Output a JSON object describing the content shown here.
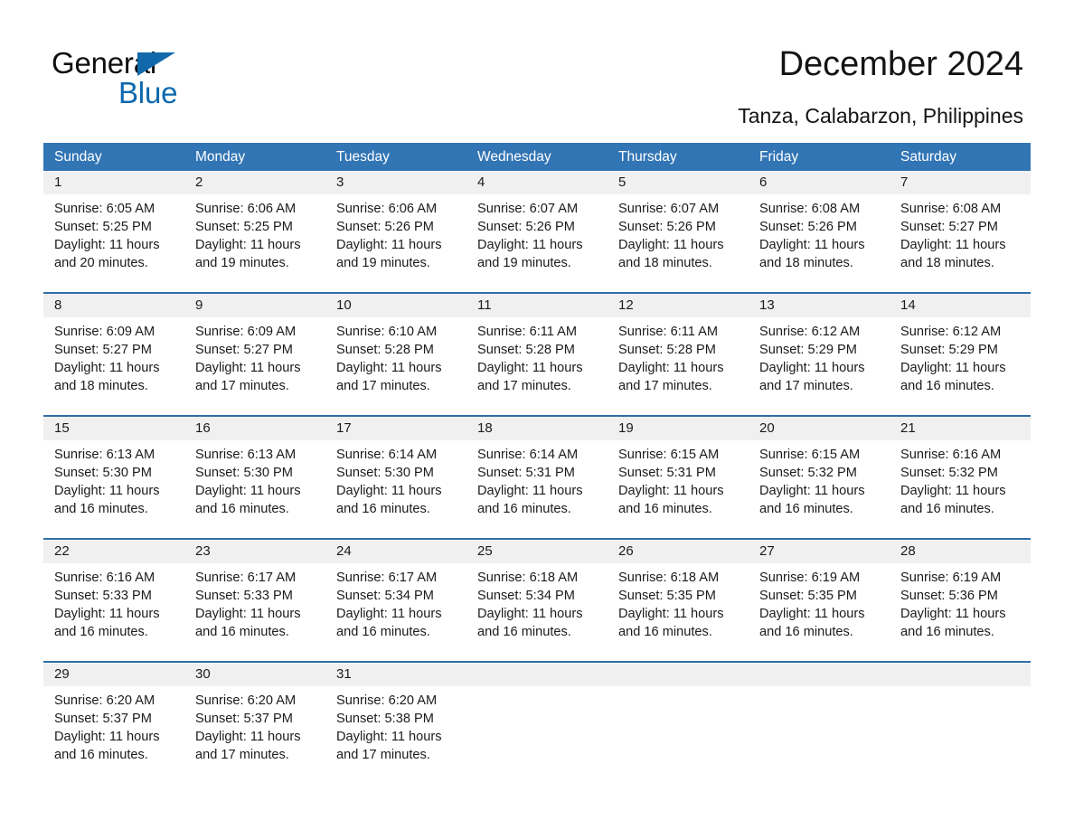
{
  "brand": {
    "word1": "General",
    "word2": "Blue",
    "triangle_color": "#1169ab",
    "text_color": "#0d68ae"
  },
  "header": {
    "title": "December 2024",
    "location": "Tanza, Calabarzon, Philippines"
  },
  "theme": {
    "header_row_bg": "#3275b4",
    "week_divider": "#2f6fa8",
    "daynum_band_bg": "#f0f0f0",
    "text": "#1b1b1b"
  },
  "calendar": {
    "weekdays": [
      "Sunday",
      "Monday",
      "Tuesday",
      "Wednesday",
      "Thursday",
      "Friday",
      "Saturday"
    ],
    "weeks": [
      [
        {
          "day": "1",
          "sunrise": "Sunrise: 6:05 AM",
          "sunset": "Sunset: 5:25 PM",
          "daylight": "Daylight: 11 hours and 20 minutes."
        },
        {
          "day": "2",
          "sunrise": "Sunrise: 6:06 AM",
          "sunset": "Sunset: 5:25 PM",
          "daylight": "Daylight: 11 hours and 19 minutes."
        },
        {
          "day": "3",
          "sunrise": "Sunrise: 6:06 AM",
          "sunset": "Sunset: 5:26 PM",
          "daylight": "Daylight: 11 hours and 19 minutes."
        },
        {
          "day": "4",
          "sunrise": "Sunrise: 6:07 AM",
          "sunset": "Sunset: 5:26 PM",
          "daylight": "Daylight: 11 hours and 19 minutes."
        },
        {
          "day": "5",
          "sunrise": "Sunrise: 6:07 AM",
          "sunset": "Sunset: 5:26 PM",
          "daylight": "Daylight: 11 hours and 18 minutes."
        },
        {
          "day": "6",
          "sunrise": "Sunrise: 6:08 AM",
          "sunset": "Sunset: 5:26 PM",
          "daylight": "Daylight: 11 hours and 18 minutes."
        },
        {
          "day": "7",
          "sunrise": "Sunrise: 6:08 AM",
          "sunset": "Sunset: 5:27 PM",
          "daylight": "Daylight: 11 hours and 18 minutes."
        }
      ],
      [
        {
          "day": "8",
          "sunrise": "Sunrise: 6:09 AM",
          "sunset": "Sunset: 5:27 PM",
          "daylight": "Daylight: 11 hours and 18 minutes."
        },
        {
          "day": "9",
          "sunrise": "Sunrise: 6:09 AM",
          "sunset": "Sunset: 5:27 PM",
          "daylight": "Daylight: 11 hours and 17 minutes."
        },
        {
          "day": "10",
          "sunrise": "Sunrise: 6:10 AM",
          "sunset": "Sunset: 5:28 PM",
          "daylight": "Daylight: 11 hours and 17 minutes."
        },
        {
          "day": "11",
          "sunrise": "Sunrise: 6:11 AM",
          "sunset": "Sunset: 5:28 PM",
          "daylight": "Daylight: 11 hours and 17 minutes."
        },
        {
          "day": "12",
          "sunrise": "Sunrise: 6:11 AM",
          "sunset": "Sunset: 5:28 PM",
          "daylight": "Daylight: 11 hours and 17 minutes."
        },
        {
          "day": "13",
          "sunrise": "Sunrise: 6:12 AM",
          "sunset": "Sunset: 5:29 PM",
          "daylight": "Daylight: 11 hours and 17 minutes."
        },
        {
          "day": "14",
          "sunrise": "Sunrise: 6:12 AM",
          "sunset": "Sunset: 5:29 PM",
          "daylight": "Daylight: 11 hours and 16 minutes."
        }
      ],
      [
        {
          "day": "15",
          "sunrise": "Sunrise: 6:13 AM",
          "sunset": "Sunset: 5:30 PM",
          "daylight": "Daylight: 11 hours and 16 minutes."
        },
        {
          "day": "16",
          "sunrise": "Sunrise: 6:13 AM",
          "sunset": "Sunset: 5:30 PM",
          "daylight": "Daylight: 11 hours and 16 minutes."
        },
        {
          "day": "17",
          "sunrise": "Sunrise: 6:14 AM",
          "sunset": "Sunset: 5:30 PM",
          "daylight": "Daylight: 11 hours and 16 minutes."
        },
        {
          "day": "18",
          "sunrise": "Sunrise: 6:14 AM",
          "sunset": "Sunset: 5:31 PM",
          "daylight": "Daylight: 11 hours and 16 minutes."
        },
        {
          "day": "19",
          "sunrise": "Sunrise: 6:15 AM",
          "sunset": "Sunset: 5:31 PM",
          "daylight": "Daylight: 11 hours and 16 minutes."
        },
        {
          "day": "20",
          "sunrise": "Sunrise: 6:15 AM",
          "sunset": "Sunset: 5:32 PM",
          "daylight": "Daylight: 11 hours and 16 minutes."
        },
        {
          "day": "21",
          "sunrise": "Sunrise: 6:16 AM",
          "sunset": "Sunset: 5:32 PM",
          "daylight": "Daylight: 11 hours and 16 minutes."
        }
      ],
      [
        {
          "day": "22",
          "sunrise": "Sunrise: 6:16 AM",
          "sunset": "Sunset: 5:33 PM",
          "daylight": "Daylight: 11 hours and 16 minutes."
        },
        {
          "day": "23",
          "sunrise": "Sunrise: 6:17 AM",
          "sunset": "Sunset: 5:33 PM",
          "daylight": "Daylight: 11 hours and 16 minutes."
        },
        {
          "day": "24",
          "sunrise": "Sunrise: 6:17 AM",
          "sunset": "Sunset: 5:34 PM",
          "daylight": "Daylight: 11 hours and 16 minutes."
        },
        {
          "day": "25",
          "sunrise": "Sunrise: 6:18 AM",
          "sunset": "Sunset: 5:34 PM",
          "daylight": "Daylight: 11 hours and 16 minutes."
        },
        {
          "day": "26",
          "sunrise": "Sunrise: 6:18 AM",
          "sunset": "Sunset: 5:35 PM",
          "daylight": "Daylight: 11 hours and 16 minutes."
        },
        {
          "day": "27",
          "sunrise": "Sunrise: 6:19 AM",
          "sunset": "Sunset: 5:35 PM",
          "daylight": "Daylight: 11 hours and 16 minutes."
        },
        {
          "day": "28",
          "sunrise": "Sunrise: 6:19 AM",
          "sunset": "Sunset: 5:36 PM",
          "daylight": "Daylight: 11 hours and 16 minutes."
        }
      ],
      [
        {
          "day": "29",
          "sunrise": "Sunrise: 6:20 AM",
          "sunset": "Sunset: 5:37 PM",
          "daylight": "Daylight: 11 hours and 16 minutes."
        },
        {
          "day": "30",
          "sunrise": "Sunrise: 6:20 AM",
          "sunset": "Sunset: 5:37 PM",
          "daylight": "Daylight: 11 hours and 17 minutes."
        },
        {
          "day": "31",
          "sunrise": "Sunrise: 6:20 AM",
          "sunset": "Sunset: 5:38 PM",
          "daylight": "Daylight: 11 hours and 17 minutes."
        },
        {
          "day": "",
          "sunrise": "",
          "sunset": "",
          "daylight": ""
        },
        {
          "day": "",
          "sunrise": "",
          "sunset": "",
          "daylight": ""
        },
        {
          "day": "",
          "sunrise": "",
          "sunset": "",
          "daylight": ""
        },
        {
          "day": "",
          "sunrise": "",
          "sunset": "",
          "daylight": ""
        }
      ]
    ]
  }
}
